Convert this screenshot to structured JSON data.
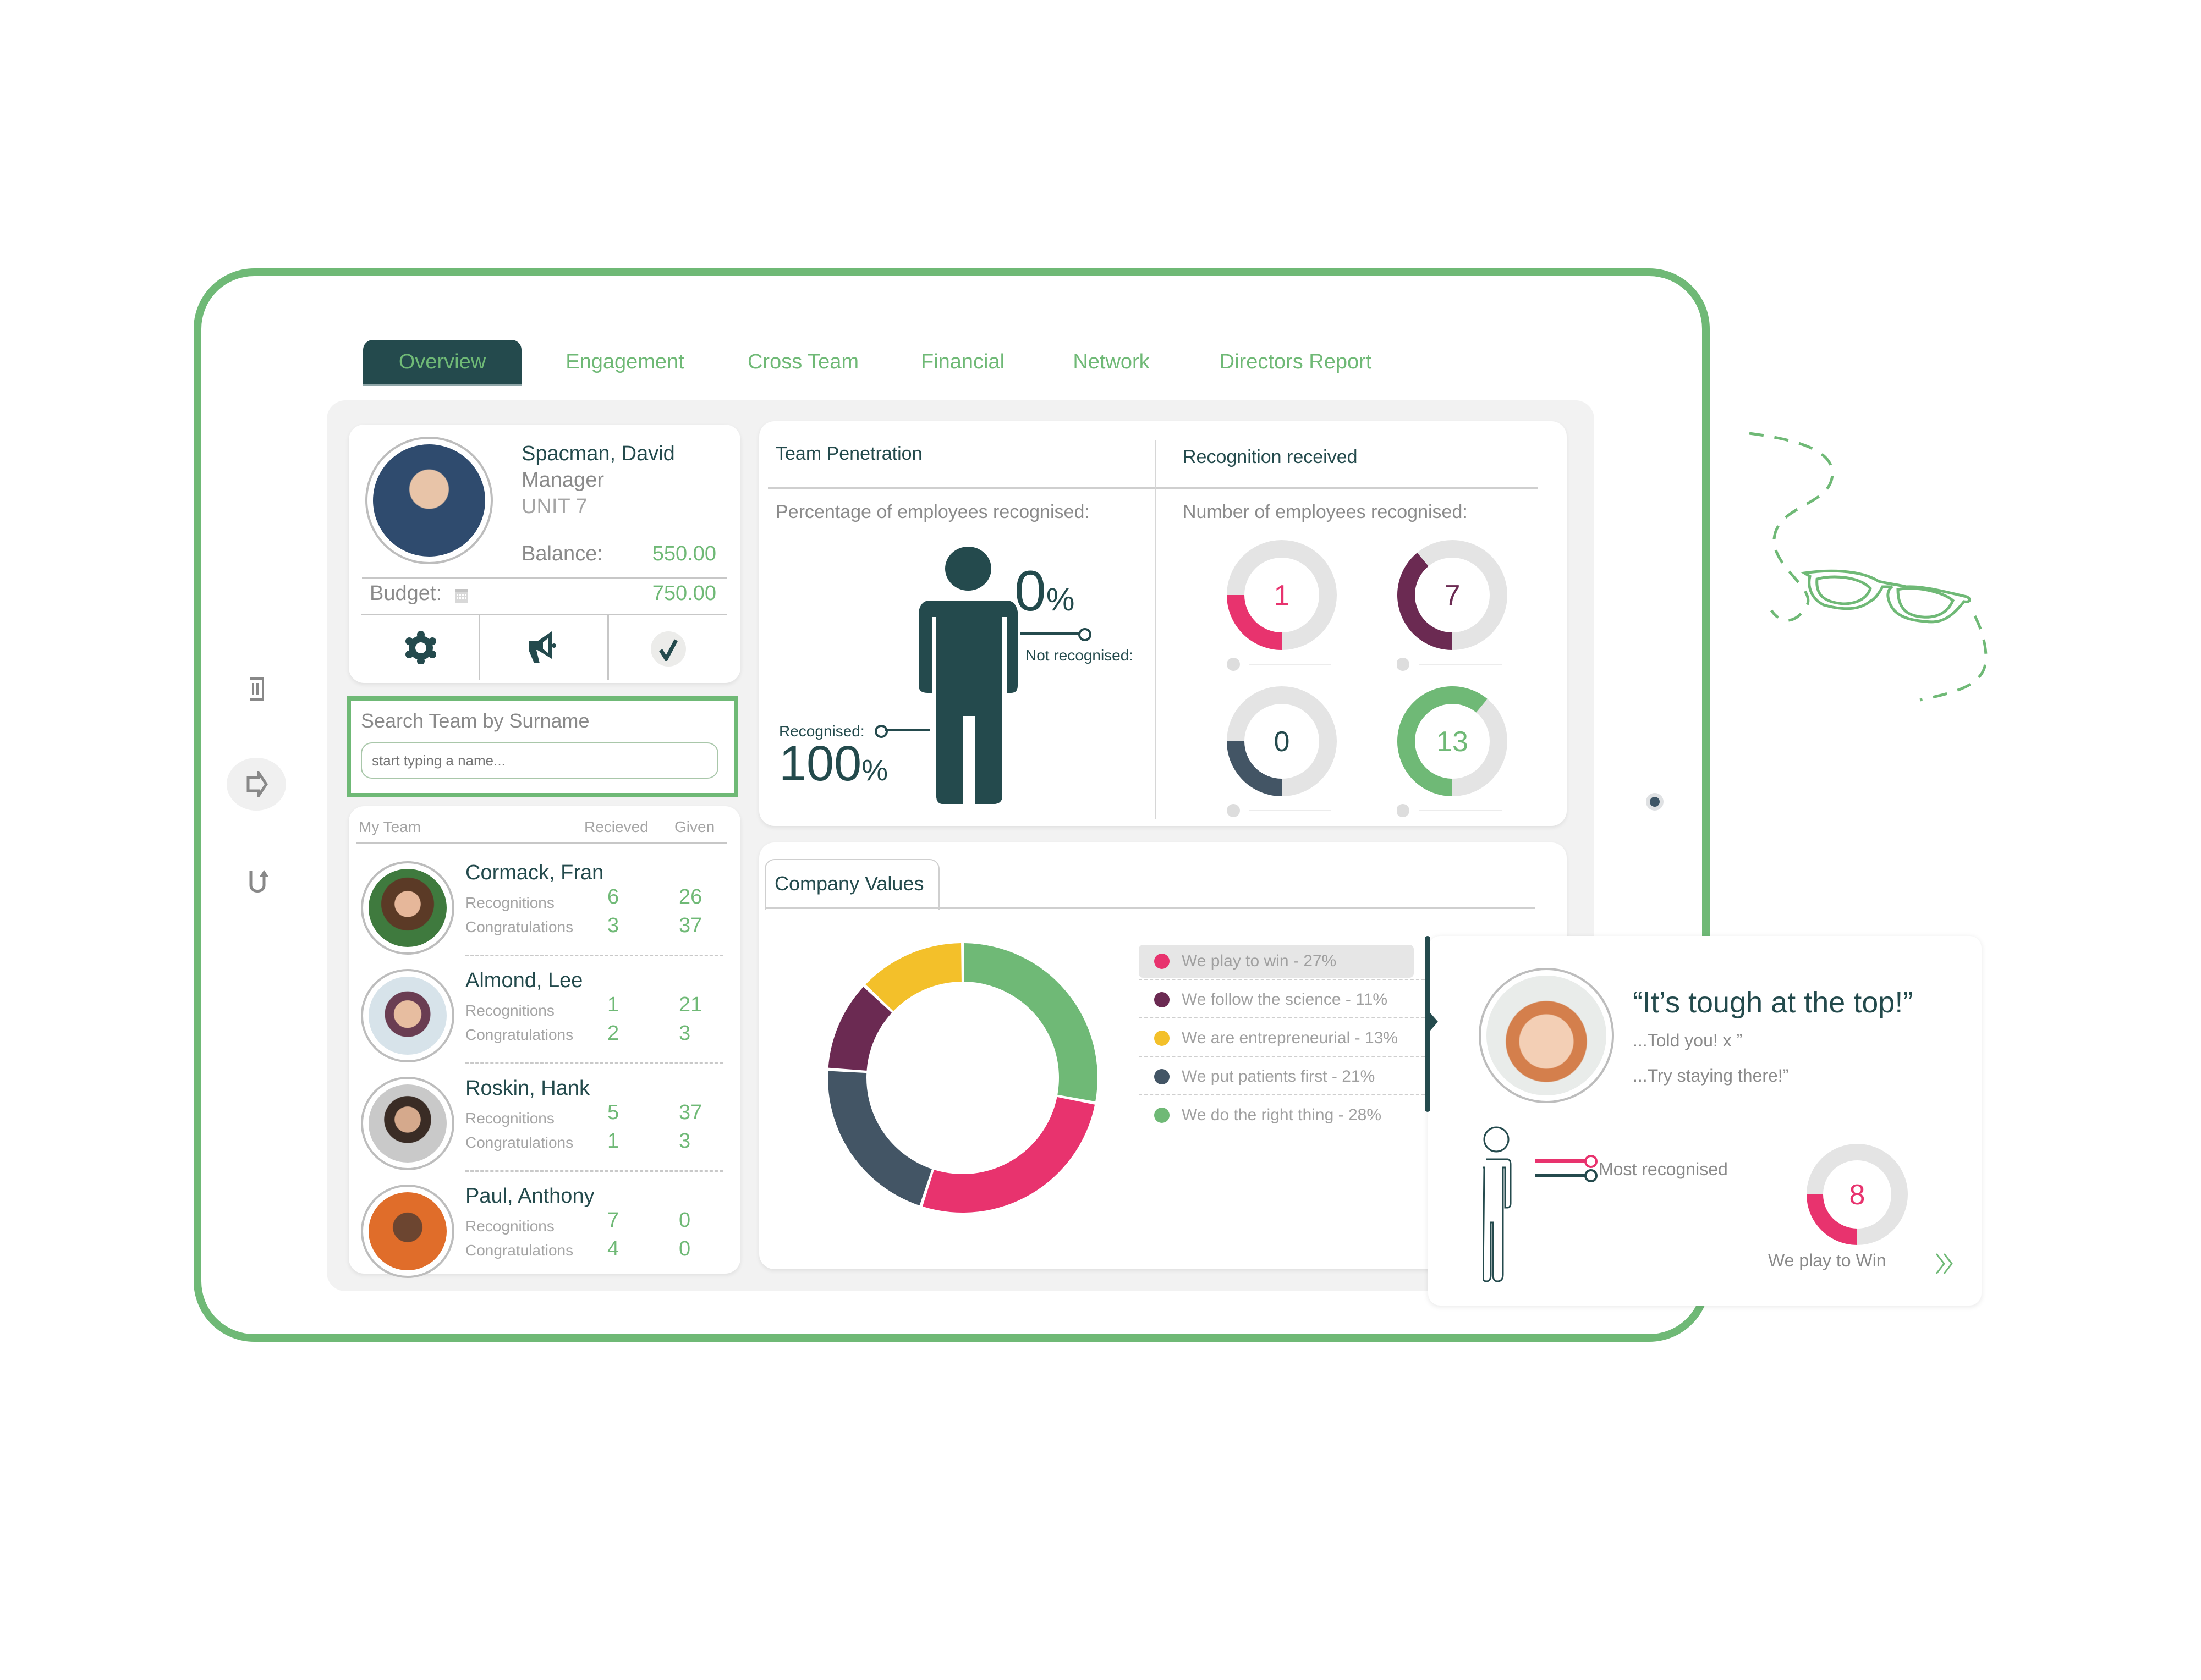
{
  "tabs": [
    {
      "label": "Overview",
      "active": true
    },
    {
      "label": "Engagement",
      "active": false
    },
    {
      "label": "Cross Team",
      "active": false
    },
    {
      "label": "Financial",
      "active": false
    },
    {
      "label": "Network",
      "active": false
    },
    {
      "label": "Directors Report",
      "active": false
    }
  ],
  "side_rail": {
    "icons": [
      "document-columns-icon",
      "arrow-right-outline-icon",
      "u-turn-arrow-icon"
    ],
    "active_index": 1
  },
  "profile": {
    "name": "Spacman, David",
    "role": "Manager",
    "unit": "UNIT 7",
    "balance_label": "Balance:",
    "balance_value": "550.00",
    "budget_label": "Budget:",
    "budget_value": "750.00",
    "actions": [
      "settings",
      "announce",
      "approve"
    ]
  },
  "search": {
    "title": "Search Team by Surname",
    "placeholder": "start typing a name..."
  },
  "team": {
    "header": {
      "team": "My Team",
      "received": "Recieved",
      "given": "Given"
    },
    "row_labels": {
      "recognitions": "Recognitions",
      "congratulations": "Congratulations"
    },
    "members": [
      {
        "name": "Cormack, Fran",
        "recognitions_received": "6",
        "recognitions_given": "26",
        "congratulations_received": "3",
        "congratulations_given": "37"
      },
      {
        "name": "Almond, Lee",
        "recognitions_received": "1",
        "recognitions_given": "21",
        "congratulations_received": "2",
        "congratulations_given": "3"
      },
      {
        "name": "Roskin, Hank",
        "recognitions_received": "5",
        "recognitions_given": "37",
        "congratulations_received": "1",
        "congratulations_given": "3"
      },
      {
        "name": "Paul, Anthony",
        "recognitions_received": "7",
        "recognitions_given": "0",
        "congratulations_received": "4",
        "congratulations_given": "0"
      }
    ]
  },
  "team_penetration": {
    "title": "Team Penetration",
    "subtitle": "Percentage of employees recognised:",
    "not_recognised_value": "0",
    "not_recognised_label": "Not recognised:",
    "recognised_label": "Recognised:",
    "recognised_value": "100",
    "percent_sign": "%"
  },
  "recognition_received": {
    "title": "Recognition received",
    "subtitle": "Number of employees recognised:",
    "gauges": [
      {
        "value": "1",
        "fraction": 0.25,
        "color": "#e8336e"
      },
      {
        "value": "7",
        "fraction": 0.39,
        "color": "#6b2a52"
      },
      {
        "value": "0",
        "fraction": 0.25,
        "color": "#435565"
      },
      {
        "value": "13",
        "fraction": 0.61,
        "color": "#6fb976"
      }
    ]
  },
  "company_values": {
    "tab_label": "Company Values"
  },
  "chart_data": {
    "type": "pie",
    "title": "Company Values",
    "donut": true,
    "categories": [
      "We play to win",
      "We follow the science",
      "We are entrepreneurial",
      "We put patients first",
      "We do the right thing"
    ],
    "values": [
      27,
      11,
      13,
      21,
      28
    ],
    "colors": [
      "#e8336e",
      "#6b2a52",
      "#f3c02a",
      "#435565",
      "#6fb976"
    ],
    "legend_labels": [
      "We play to win - 27%",
      "We follow the science -  11%",
      "We are entrepreneurial - 13%",
      "We put patients first  - 21%",
      "We do the right thing - 28%"
    ],
    "legend_position": "right",
    "highlighted_index": 0
  },
  "popup": {
    "quote": "“It’s tough at the top!”",
    "reply1": "...Told you! x ”",
    "reply2": "...Try staying there!”",
    "most_recognised_label": "Most recognised",
    "gauge_value": "8",
    "gauge_fraction": 0.25,
    "gauge_color": "#e8336e",
    "value_label": "We play to Win"
  },
  "colors": {
    "brand_green": "#6fb976",
    "dark_teal": "#244a4d",
    "pink": "#e8336e",
    "plum": "#6b2a52",
    "yellow": "#f3c02a",
    "slate": "#435565"
  }
}
